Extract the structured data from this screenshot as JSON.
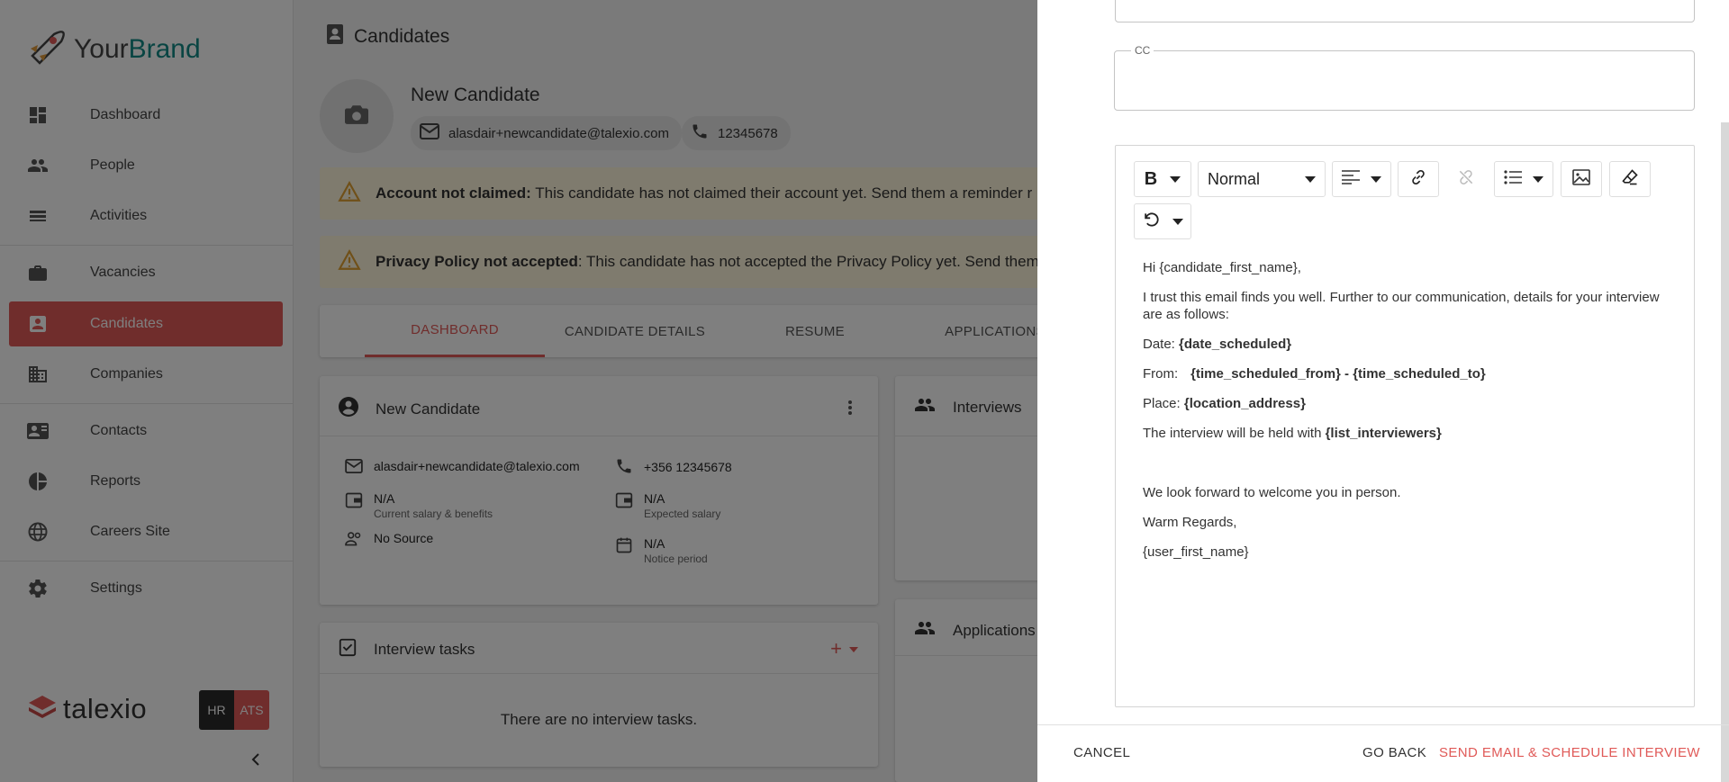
{
  "brand": {
    "name_part1": "Your",
    "name_part2": "Brand",
    "footer_logo": "talexio"
  },
  "sidebar": {
    "items": [
      {
        "label": "Dashboard",
        "icon": "dashboard-icon"
      },
      {
        "label": "People",
        "icon": "people-icon"
      },
      {
        "label": "Activities",
        "icon": "activities-icon"
      },
      {
        "label": "Vacancies",
        "icon": "briefcase-icon"
      },
      {
        "label": "Candidates",
        "icon": "candidate-icon",
        "active": true
      },
      {
        "label": "Companies",
        "icon": "building-icon"
      },
      {
        "label": "Contacts",
        "icon": "contact-card-icon"
      },
      {
        "label": "Reports",
        "icon": "pie-chart-icon"
      },
      {
        "label": "Careers Site",
        "icon": "globe-icon"
      },
      {
        "label": "Settings",
        "icon": "gear-icon"
      }
    ],
    "toggle": {
      "hr": "HR",
      "ats": "ATS"
    }
  },
  "header": {
    "title": "Candidates"
  },
  "candidate": {
    "name": "New Candidate",
    "email": "alasdair+newcandidate@talexio.com",
    "phone": "12345678",
    "phone_full": "+356 12345678"
  },
  "alerts": [
    {
      "title": "Account not claimed:",
      "text": " This candidate has not claimed their account yet. Send them a reminder r"
    },
    {
      "title": "Privacy Policy not accepted",
      "text": ": This candidate has not accepted the Privacy Policy yet. Send them"
    }
  ],
  "tabs": [
    "DASHBOARD",
    "CANDIDATE DETAILS",
    "RESUME",
    "APPLICATIONS"
  ],
  "profile_card": {
    "title": "New Candidate",
    "current_salary": "N/A",
    "current_salary_label": "Current salary & benefits",
    "expected_salary": "N/A",
    "expected_salary_label": "Expected salary",
    "source": "No Source",
    "notice": "N/A",
    "notice_label": "Notice period"
  },
  "interviews_card": {
    "title": "Interviews"
  },
  "applications_card": {
    "title": "Applications"
  },
  "tasks_card": {
    "title": "Interview tasks",
    "empty": "There are no interview tasks."
  },
  "drawer": {
    "cc_label": "CC",
    "cc_value": "",
    "top_field_value": "",
    "toolbar": {
      "format": "Normal"
    },
    "body": {
      "greeting": "Hi {candidate_first_name},",
      "intro": "I trust this email finds you well. Further to our communication, details for your interview are as follows:",
      "date_label": "Date: ",
      "date_value": "{date_scheduled}",
      "from_label": "From:",
      "from_value": "{time_scheduled_from} - {time_scheduled_to}",
      "place_label": "Place: ",
      "place_value": "{location_address}",
      "held_label": "The interview will be held with ",
      "held_value": "{list_interviewers}",
      "closing": "We look forward to welcome you in person.",
      "regards": "Warm Regards,",
      "signature": "{user_first_name}"
    },
    "footer": {
      "cancel": "CANCEL",
      "back": "GO BACK",
      "submit": "SEND EMAIL & SCHEDULE INTERVIEW"
    }
  },
  "colors": {
    "accent": "#e05a58",
    "brand_teal": "#138a86",
    "alert_bg": "#fff6dd"
  }
}
